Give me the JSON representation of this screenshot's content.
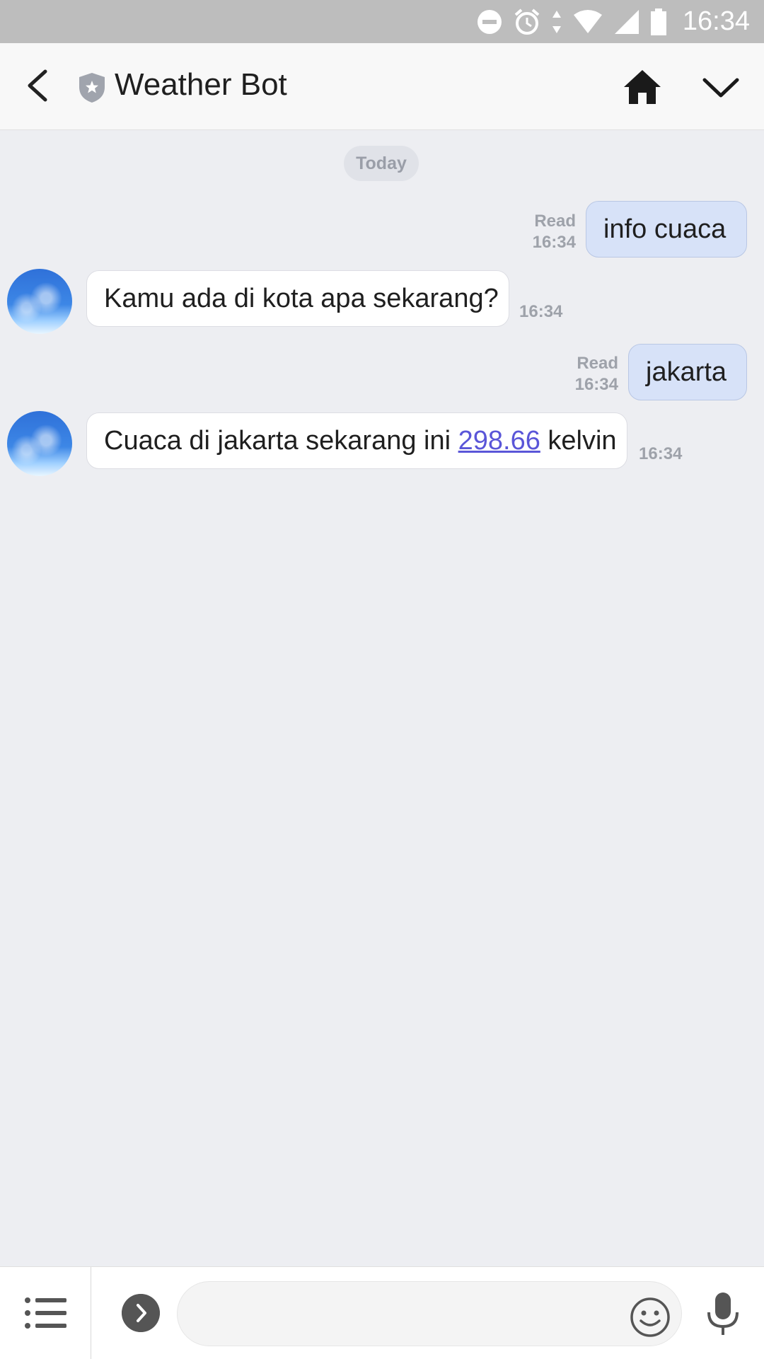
{
  "status_bar": {
    "time": "16:34"
  },
  "header": {
    "title": "Weather Bot"
  },
  "chat": {
    "date_chip": "Today",
    "messages": [
      {
        "dir": "out",
        "text": "info cuaca",
        "read": "Read",
        "time": "16:34"
      },
      {
        "dir": "in",
        "text": "Kamu ada di kota apa sekarang?",
        "time": "16:34"
      },
      {
        "dir": "out",
        "text": "jakarta",
        "read": "Read",
        "time": "16:34"
      },
      {
        "dir": "in",
        "text_before": "Cuaca di jakarta sekarang ini ",
        "link": "298.66",
        "text_after": " kelvin",
        "time": "16:34"
      }
    ]
  },
  "input": {
    "placeholder": ""
  },
  "colors": {
    "chat_bg": "#edeef2",
    "out_bubble": "#d7e2f8",
    "link": "#5a56d8"
  }
}
